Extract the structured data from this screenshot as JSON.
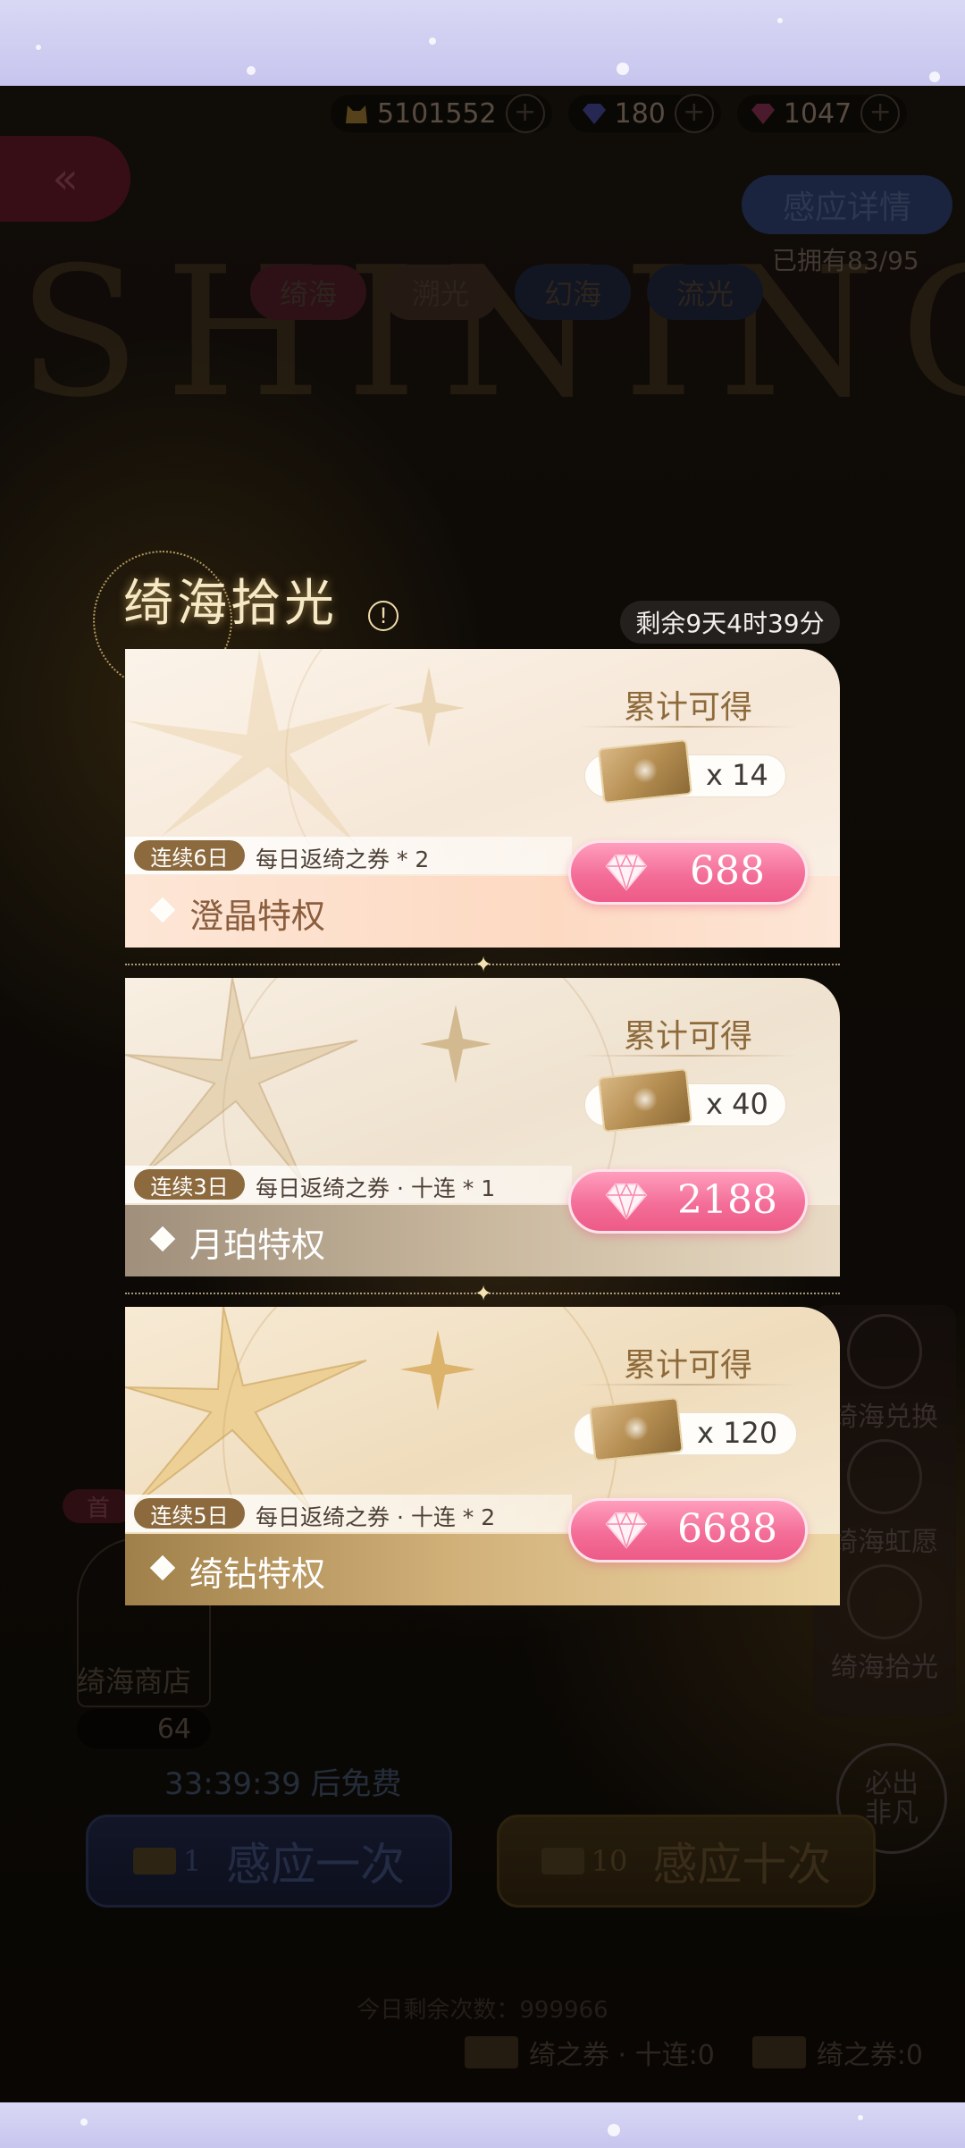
{
  "currency": {
    "gold": "5101552",
    "blue_gem": "180",
    "pink_gem": "1047"
  },
  "background": {
    "watermark": "SHINING",
    "detail_button": "感应详情",
    "owned": "已拥有83/95",
    "tabs": [
      "绮海",
      "溯光",
      "幻海",
      "流光"
    ],
    "side_menu": [
      "绮海兑换",
      "绮海虹愿",
      "绮海拾光"
    ],
    "guarantee": "必出\n非凡",
    "first_tag": "首",
    "shop_label": "绮海商店",
    "shop_count": "64",
    "free_timer": "33:39:39 后免费",
    "draw_one": {
      "count": "1",
      "label": "感应一次"
    },
    "draw_ten": {
      "count": "10",
      "label": "感应十次"
    },
    "remaining_today": "今日剩余次数：999966",
    "ticket_ten": "绮之券 · 十连:0",
    "ticket_single": "绮之券:0"
  },
  "popup": {
    "title": "绮海拾光",
    "info_icon": "!",
    "time_left": "剩余9天4时39分",
    "cards": [
      {
        "reward_head": "累计可得",
        "qty": "x 14",
        "price": "688",
        "streak": "连续6日",
        "desc": "每日返绮之券 * 2",
        "tier": "澄晶特权"
      },
      {
        "reward_head": "累计可得",
        "qty": "x 40",
        "price": "2188",
        "streak": "连续3日",
        "desc": "每日返绮之券 · 十连 * 1",
        "tier": "月珀特权"
      },
      {
        "reward_head": "累计可得",
        "qty": "x 120",
        "price": "6688",
        "streak": "连续5日",
        "desc": "每日返绮之券 · 十连 * 2",
        "tier": "绮钻特权"
      }
    ]
  },
  "colors": {
    "price_button": "#f36e98",
    "streak_tag": "#8c6a3e",
    "frame": "#d9d8f4"
  }
}
